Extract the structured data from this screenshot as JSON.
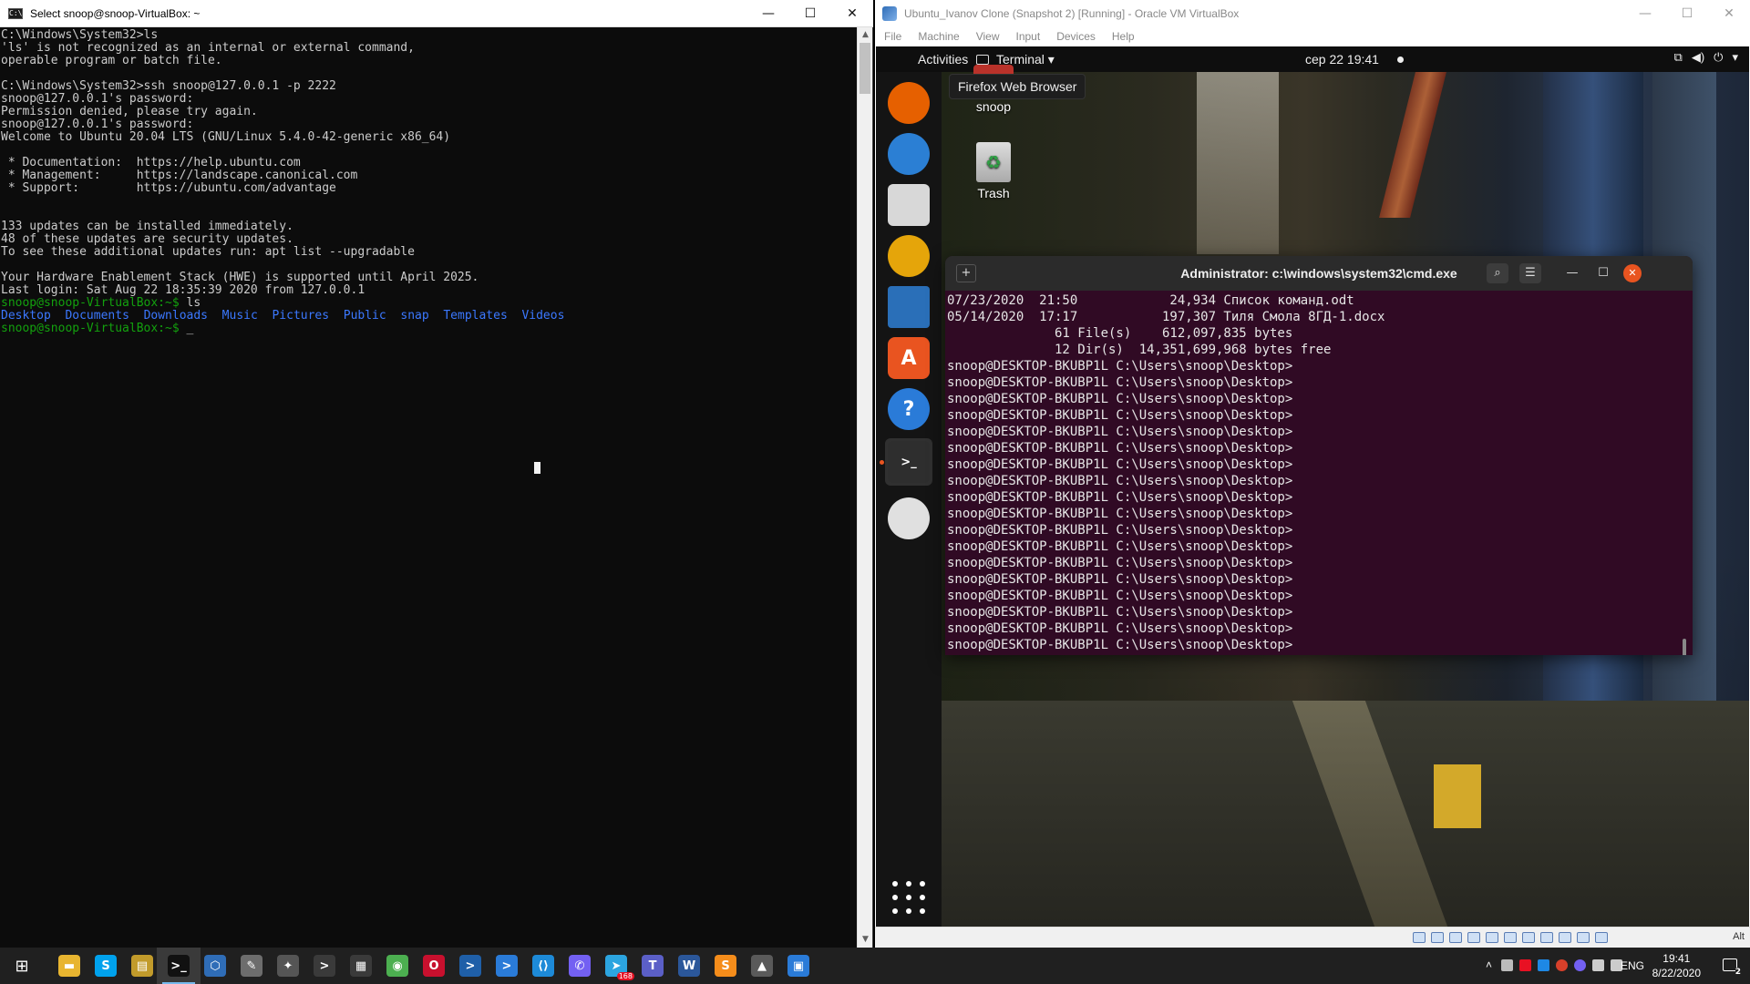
{
  "cmd": {
    "title": "Select snoop@snoop-VirtualBox: ~",
    "lines": [
      "C:\\Windows\\System32>ls",
      "'ls' is not recognized as an internal or external command,",
      "operable program or batch file.",
      "",
      "C:\\Windows\\System32>ssh snoop@127.0.0.1 -p 2222",
      "snoop@127.0.0.1's password:",
      "Permission denied, please try again.",
      "snoop@127.0.0.1's password:",
      "Welcome to Ubuntu 20.04 LTS (GNU/Linux 5.4.0-42-generic x86_64)",
      "",
      " * Documentation:  https://help.ubuntu.com",
      " * Management:     https://landscape.canonical.com",
      " * Support:        https://ubuntu.com/advantage",
      "",
      "",
      "133 updates can be installed immediately.",
      "48 of these updates are security updates.",
      "To see these additional updates run: apt list --upgradable",
      "",
      "Your Hardware Enablement Stack (HWE) is supported until April 2025.",
      "Last login: Sat Aug 22 18:35:39 2020 from 127.0.0.1"
    ],
    "prompt": "snoop@snoop-VirtualBox:~$",
    "ls_cmd": " ls",
    "ls_output": [
      "Desktop",
      "Documents",
      "Downloads",
      "Music",
      "Pictures",
      "Public",
      "snap",
      "Templates",
      "Videos"
    ],
    "prompt2": "snoop@snoop-VirtualBox:~$",
    "cursor": "_"
  },
  "vbox": {
    "title": "Ubuntu_Ivanov Clone (Snapshot 2) [Running] - Oracle VM VirtualBox",
    "menu": [
      "File",
      "Machine",
      "View",
      "Input",
      "Devices",
      "Help"
    ],
    "host_key": "Alt"
  },
  "gnome": {
    "activities": "Activities",
    "app_menu": "Terminal ▾",
    "clock": "сер 22  19:41",
    "tray_icons": [
      "network-icon",
      "volume-icon",
      "power-icon",
      "chevron-down-icon"
    ],
    "tooltip": "Firefox Web Browser",
    "desktop_icons": [
      "snoop",
      "Trash"
    ],
    "dock": [
      {
        "name": "firefox",
        "color": "#e66000"
      },
      {
        "name": "thunderbird",
        "color": "#2b7fd4"
      },
      {
        "name": "files",
        "color": "#d8d8d8"
      },
      {
        "name": "rhythmbox",
        "color": "#e5a50a"
      },
      {
        "name": "libreoffice-writer",
        "color": "#2a6fb8"
      },
      {
        "name": "ubuntu-software",
        "color": "#e95420"
      },
      {
        "name": "help",
        "color": "#2a7bd8"
      },
      {
        "name": "terminal",
        "color": "#2e2e2e"
      },
      {
        "name": "dvd",
        "color": "#e0e0e0"
      }
    ]
  },
  "guest_terminal": {
    "title": "Administrator: c:\\windows\\system32\\cmd.exe",
    "lines": [
      "07/23/2020  21:50            24,934 Список команд.odt",
      "05/14/2020  17:17           197,307 Тиля Смола 8ГД-1.docx",
      "              61 File(s)    612,097,835 bytes",
      "              12 Dir(s)  14,351,699,968 bytes free",
      "",
      "snoop@DESKTOP-BKUBP1L C:\\Users\\snoop\\Desktop>",
      "snoop@DESKTOP-BKUBP1L C:\\Users\\snoop\\Desktop>",
      "snoop@DESKTOP-BKUBP1L C:\\Users\\snoop\\Desktop>",
      "snoop@DESKTOP-BKUBP1L C:\\Users\\snoop\\Desktop>",
      "snoop@DESKTOP-BKUBP1L C:\\Users\\snoop\\Desktop>",
      "snoop@DESKTOP-BKUBP1L C:\\Users\\snoop\\Desktop>",
      "snoop@DESKTOP-BKUBP1L C:\\Users\\snoop\\Desktop>",
      "snoop@DESKTOP-BKUBP1L C:\\Users\\snoop\\Desktop>",
      "snoop@DESKTOP-BKUBP1L C:\\Users\\snoop\\Desktop>",
      "snoop@DESKTOP-BKUBP1L C:\\Users\\snoop\\Desktop>",
      "snoop@DESKTOP-BKUBP1L C:\\Users\\snoop\\Desktop>",
      "snoop@DESKTOP-BKUBP1L C:\\Users\\snoop\\Desktop>",
      "snoop@DESKTOP-BKUBP1L C:\\Users\\snoop\\Desktop>",
      "snoop@DESKTOP-BKUBP1L C:\\Users\\snoop\\Desktop>",
      "snoop@DESKTOP-BKUBP1L C:\\Users\\snoop\\Desktop>",
      "snoop@DESKTOP-BKUBP1L C:\\Users\\snoop\\Desktop>",
      "snoop@DESKTOP-BKUBP1L C:\\Users\\snoop\\Desktop>",
      "snoop@DESKTOP-BKUBP1L C:\\Users\\snoop\\Desktop>",
      "snoop@DESKTOP-BKUBP1L C:\\Users\\snoop\\Desktop>",
      "snoop@DESKTOP-BKUBP1L C:\\Users\\snoop\\Desktop>",
      "snoop@DESKTOP-BKUBP1L C:\\Users\\snoop\\Desktop>"
    ]
  },
  "taskbar": {
    "apps": [
      {
        "name": "start",
        "glyph": "⊞",
        "color": "#202020"
      },
      {
        "name": "file-explorer",
        "glyph": "▬",
        "color": "#e8b530"
      },
      {
        "name": "skype",
        "glyph": "S",
        "color": "#00a2ed"
      },
      {
        "name": "archiver",
        "glyph": "▤",
        "color": "#c29b2b"
      },
      {
        "name": "cmd",
        "glyph": ">_",
        "color": "#111111",
        "active": true
      },
      {
        "name": "virtualbox",
        "glyph": "⬡",
        "color": "#2f6db7"
      },
      {
        "name": "gimp",
        "glyph": "✎",
        "color": "#6d6d6d"
      },
      {
        "name": "app-blender",
        "glyph": "✦",
        "color": "#555555"
      },
      {
        "name": "terminal-app",
        "glyph": ">",
        "color": "#3a3a3a"
      },
      {
        "name": "calculator",
        "glyph": "▦",
        "color": "#3a3a3a"
      },
      {
        "name": "chrome",
        "glyph": "◉",
        "color": "#4caf50"
      },
      {
        "name": "opera",
        "glyph": "O",
        "color": "#c8102e"
      },
      {
        "name": "powershell",
        "glyph": ">",
        "color": "#1f5fa8"
      },
      {
        "name": "powershell-ise",
        "glyph": ">",
        "color": "#2a7bd8"
      },
      {
        "name": "vscode",
        "glyph": "⟨⟩",
        "color": "#1d8ad8"
      },
      {
        "name": "viber",
        "glyph": "✆",
        "color": "#7360f2"
      },
      {
        "name": "telegram",
        "glyph": "➤",
        "color": "#2ca5e0",
        "badge": "168"
      },
      {
        "name": "teams",
        "glyph": "T",
        "color": "#5b5fc7"
      },
      {
        "name": "word",
        "glyph": "W",
        "color": "#2b579a"
      },
      {
        "name": "sublime",
        "glyph": "S",
        "color": "#f58d1b"
      },
      {
        "name": "photos",
        "glyph": "▲",
        "color": "#5a5a5a"
      },
      {
        "name": "remote-desktop",
        "glyph": "▣",
        "color": "#2a7bd8"
      }
    ],
    "language": "ENG",
    "time": "19:41",
    "date": "8/22/2020",
    "notifications": "2"
  }
}
